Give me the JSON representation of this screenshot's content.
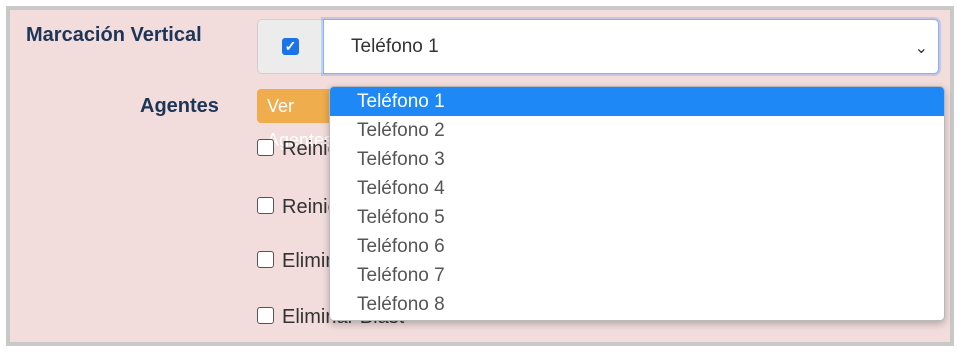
{
  "form": {
    "vertical_label": "Marcación Vertical",
    "vertical_checked": true,
    "selected_phone": "Teléfono 1",
    "agents_label": "Agentes",
    "agents_button": "Ver Agentes",
    "checkboxes": [
      {
        "label": "Reiniciar",
        "checked": false
      },
      {
        "label": "Reiniciar",
        "checked": false
      },
      {
        "label": "Eliminar",
        "checked": false
      },
      {
        "label": "Eliminar Blast",
        "checked": false
      }
    ]
  },
  "dropdown": {
    "options": [
      "Teléfono 1",
      "Teléfono 2",
      "Teléfono 3",
      "Teléfono 4",
      "Teléfono 5",
      "Teléfono 6",
      "Teléfono 7",
      "Teléfono 8"
    ],
    "highlighted_index": 0
  },
  "colors": {
    "highlight": "#1e88f7",
    "button": "#f0ad4e",
    "panel": "#f2dcdc",
    "label": "#1d3557"
  },
  "icons": {
    "checkbox": "check-icon",
    "select": "chevron-down-icon"
  }
}
